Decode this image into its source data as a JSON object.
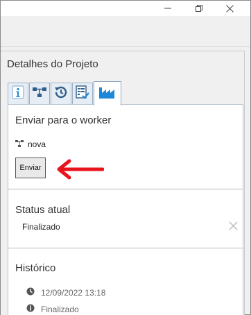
{
  "window": {
    "controls": {
      "minimize_icon": "minimize-icon",
      "restore_icon": "restore-icon",
      "close_icon": "close-icon"
    }
  },
  "panel": {
    "title": "Detalhes do Projeto",
    "tabs": [
      {
        "icon": "info-icon",
        "active": false
      },
      {
        "icon": "workflow-icon",
        "active": false
      },
      {
        "icon": "history-icon",
        "active": false
      },
      {
        "icon": "checklist-icon",
        "active": false
      },
      {
        "icon": "factory-icon",
        "active": true
      }
    ]
  },
  "send": {
    "title": "Enviar para o worker",
    "worker_name": "nova",
    "button_label": "Enviar"
  },
  "status": {
    "title": "Status atual",
    "value": "Finalizado"
  },
  "history": {
    "title": "Histórico",
    "entries": [
      {
        "icon": "clock-icon",
        "text": "12/09/2022 13:18"
      },
      {
        "icon": "info-circle-icon",
        "text": "Finalizado"
      }
    ]
  },
  "colors": {
    "accent": "#1e88d8",
    "arrow": "#e8141c"
  }
}
